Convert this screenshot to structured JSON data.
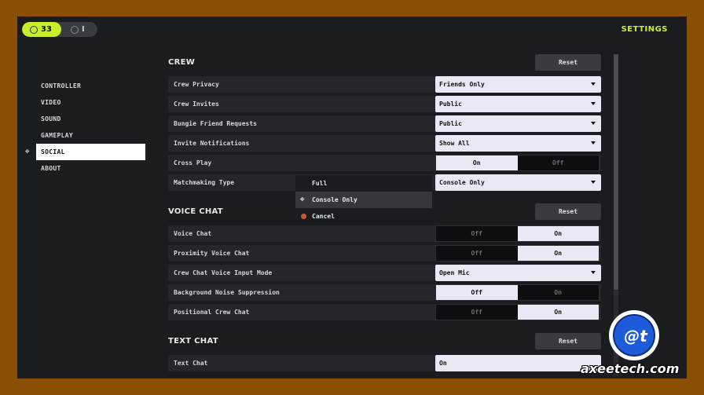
{
  "header": {
    "badge_primary": "33",
    "badge_secondary": "I",
    "title": "SETTINGS"
  },
  "sidebar": {
    "items": [
      {
        "label": "CONTROLLER",
        "active": false
      },
      {
        "label": "VIDEO",
        "active": false
      },
      {
        "label": "SOUND",
        "active": false
      },
      {
        "label": "GAMEPLAY",
        "active": false
      },
      {
        "label": "SOCIAL",
        "active": true
      },
      {
        "label": "ABOUT",
        "active": false
      }
    ]
  },
  "crew": {
    "title": "CREW",
    "reset": "Reset",
    "privacy": {
      "label": "Crew Privacy",
      "value": "Friends Only"
    },
    "invites": {
      "label": "Crew Invites",
      "value": "Public"
    },
    "friend_requests": {
      "label": "Bungie Friend Requests",
      "value": "Public"
    },
    "notifications": {
      "label": "Invite Notifications",
      "value": "Show All"
    },
    "cross_play": {
      "label": "Cross Play",
      "on": "On",
      "off": "Off",
      "selected": "On"
    },
    "matchmaking": {
      "label": "Matchmaking Type",
      "value": "Console Only"
    }
  },
  "popup": {
    "options": [
      "Full",
      "Console Only",
      "Cancel"
    ],
    "highlighted": "Console Only"
  },
  "voice": {
    "title": "VOICE CHAT",
    "reset": "Reset",
    "voice_chat": {
      "label": "Voice Chat",
      "off": "Off",
      "on": "On",
      "selected": "On"
    },
    "proximity": {
      "label": "Proximity Voice Chat",
      "off": "Off",
      "on": "On",
      "selected": "On"
    },
    "input_mode": {
      "label": "Crew Chat Voice Input Mode",
      "value": "Open Mic"
    },
    "noise": {
      "label": "Background Noise Suppression",
      "off": "Off",
      "on": "On",
      "selected": "Off"
    },
    "positional": {
      "label": "Positional Crew Chat",
      "off": "Off",
      "on": "On",
      "selected": "On"
    }
  },
  "text": {
    "title": "TEXT CHAT",
    "reset": "Reset",
    "text_chat": {
      "label": "Text Chat",
      "value": "On"
    }
  },
  "watermark": {
    "site": "axeetech.com"
  },
  "colors": {
    "accent": "#c9ef2c",
    "background": "#1b1c20",
    "frame": "#8a4f05"
  }
}
